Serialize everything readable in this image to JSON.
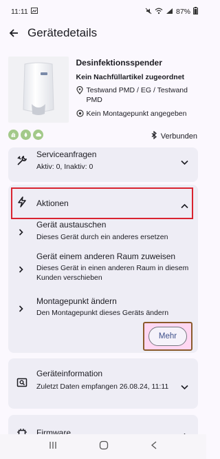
{
  "status_bar": {
    "time": "11:11",
    "battery": "87%"
  },
  "app_bar": {
    "title": "Gerätedetails"
  },
  "device": {
    "name": "Desinfektionsspender",
    "refill": "Kein Nachfüllartikel zugeordnet",
    "location": "Testwand PMD / EG / Testwand PMD",
    "mount": "Kein Montagepunkt angegeben",
    "connection": "Verbunden"
  },
  "service": {
    "title": "Serviceanfragen",
    "counts": "Aktiv: 0, Inaktiv: 0"
  },
  "actions": {
    "title": "Aktionen",
    "items": [
      {
        "title": "Gerät austauschen",
        "desc": "Dieses Gerät durch ein anderes ersetzen"
      },
      {
        "title": "Gerät einem anderen Raum zuweisen",
        "desc": "Dieses Gerät in einen anderen Raum in diesem Kunden verschieben"
      },
      {
        "title": "Montagepunkt ändern",
        "desc": "Den Montagepunkt dieses Geräts ändern"
      }
    ],
    "more_label": "Mehr"
  },
  "device_info": {
    "title": "Geräteinformation",
    "last_data": "Zuletzt Daten empfangen 26.08.24, 11:11"
  },
  "firmware": {
    "title": "Firmware"
  },
  "colors": {
    "card_bg": "#eeedf5",
    "highlight": "#d9232f",
    "chip": "#a3c98a",
    "page_bg": "#fbf8fe"
  }
}
